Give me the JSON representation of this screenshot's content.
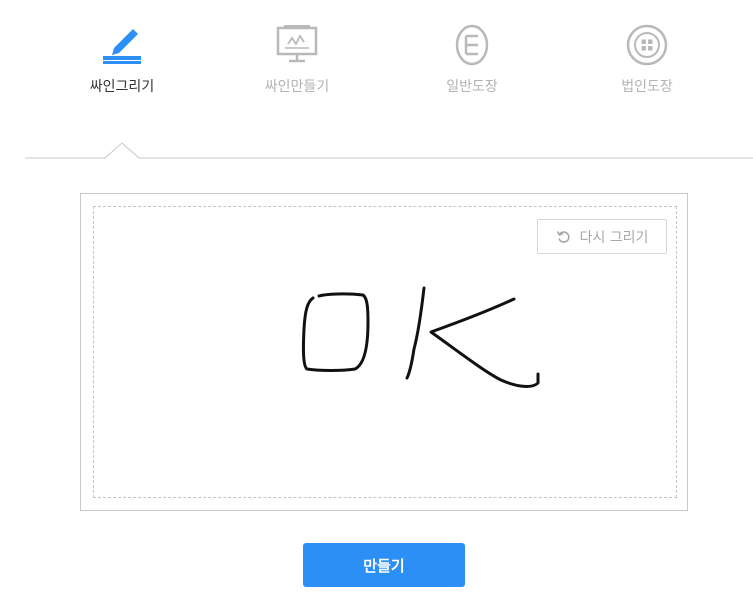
{
  "tabs": [
    {
      "label": "싸인그리기",
      "icon": "pen-draw-icon",
      "active": true
    },
    {
      "label": "싸인만들기",
      "icon": "monitor-signature-icon",
      "active": false
    },
    {
      "label": "일반도장",
      "icon": "oval-stamp-icon",
      "active": false
    },
    {
      "label": "법인도장",
      "icon": "round-stamp-icon",
      "active": false
    }
  ],
  "canvas": {
    "redraw_label": "다시 그리기",
    "redraw_icon": "rotate-ccw-icon"
  },
  "make_button_label": "만들기",
  "colors": {
    "accent": "#2b8ff5",
    "active_text": "#333333",
    "inactive": "#b3b3b3"
  }
}
